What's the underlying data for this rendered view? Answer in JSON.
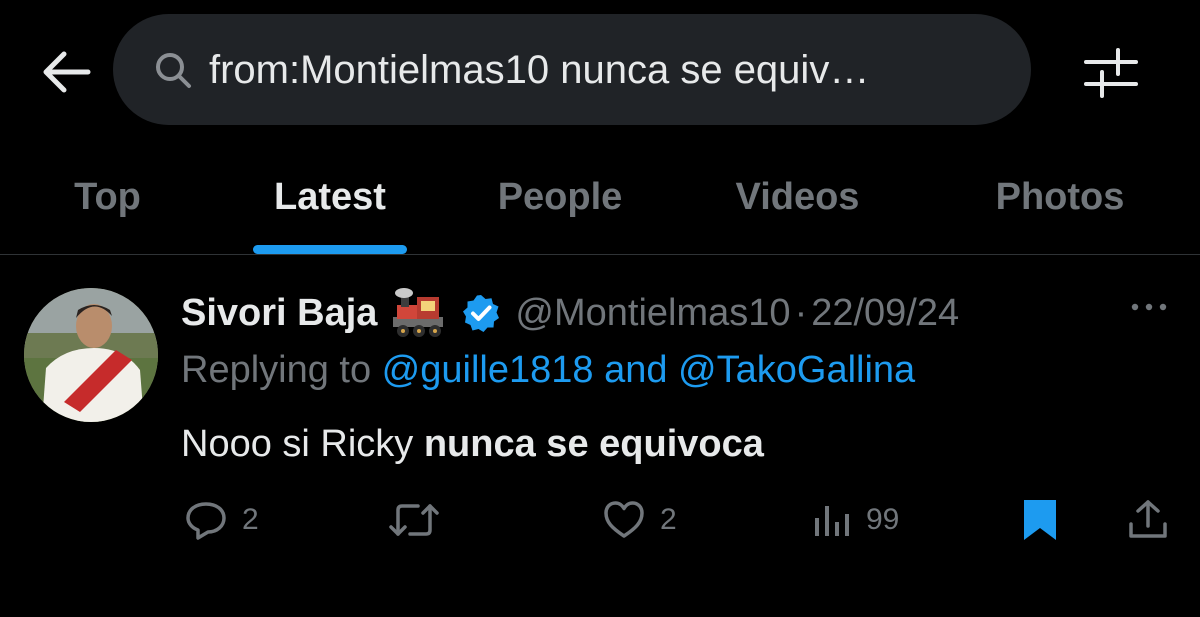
{
  "search": {
    "query": "from:Montielmas10  nunca se equiv…"
  },
  "tabs": [
    {
      "label": "Top"
    },
    {
      "label": "Latest"
    },
    {
      "label": "People"
    },
    {
      "label": "Videos"
    },
    {
      "label": "Photos"
    }
  ],
  "active_tab": "Latest",
  "tweet": {
    "display_name": "Sivori Baja",
    "emoji": "steam-locomotive",
    "verified": true,
    "handle": "@Montielmas10",
    "separator": "·",
    "date": "22/09/24",
    "replying_prefix": "Replying to ",
    "replying_user1": "@guille1818",
    "replying_and": " and ",
    "replying_user2": "@TakoGallina",
    "text_plain": "Nooo si Ricky ",
    "text_bold": "nunca se equivoca",
    "replies": "2",
    "likes": "2",
    "views": "99",
    "bookmarked": true
  },
  "colors": {
    "background": "#000000",
    "accent": "#1d9bf0",
    "text": "#e7e9ea",
    "muted": "#71767b",
    "search_bg": "#202327"
  },
  "icons": [
    "back-arrow-icon",
    "search-icon",
    "filter-icon",
    "more-icon",
    "reply-icon",
    "retweet-icon",
    "like-icon",
    "views-icon",
    "bookmark-icon",
    "share-icon",
    "verified-icon",
    "steam-locomotive-emoji"
  ]
}
